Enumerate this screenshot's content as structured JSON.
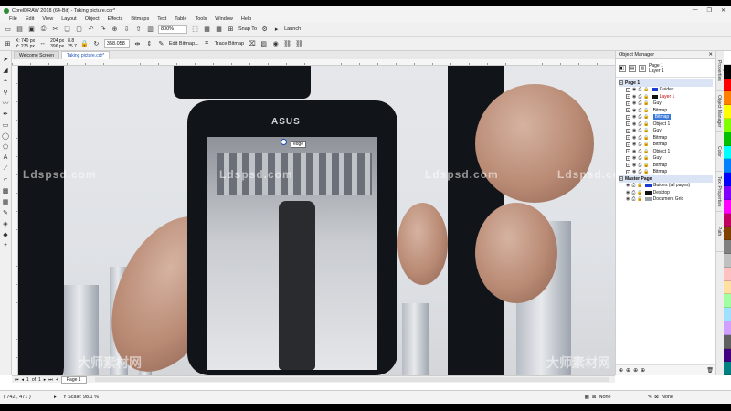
{
  "window": {
    "title": "CorelDRAW 2018 (64-Bit) - Taking picture.cdr*",
    "buttons": [
      "—",
      "❐",
      "✕"
    ]
  },
  "menu": [
    "File",
    "Edit",
    "View",
    "Layout",
    "Object",
    "Effects",
    "Bitmaps",
    "Text",
    "Table",
    "Tools",
    "Window",
    "Help"
  ],
  "toolbar": {
    "zoom": "800%",
    "snap_to": "Snap To",
    "launch": "Launch"
  },
  "property_bar": {
    "x": "X: 740 px",
    "y": "Y: 275 px",
    "w": "204 px",
    "h": "396 px",
    "sx": "8.8",
    "sy": "25.7",
    "angle": "358.058",
    "edit_bitmap": "Edit Bitmap...",
    "trace_bitmap": "Trace Bitmap"
  },
  "tabs": [
    "Welcome Screen",
    "Taking picture.cdr*"
  ],
  "canvas": {
    "watermarks": [
      "Ldspsd.com",
      "Ldspsd.com",
      "Ldspsd.com",
      "Ldspsd.com"
    ],
    "watermark_cn": "大师素材网",
    "phone_brand": "ASUS",
    "tooltip": "edge"
  },
  "object_manager": {
    "title": "Object Manager",
    "page_info": [
      "Page 1",
      "Layer 1"
    ],
    "page1_label": "Page 1",
    "items": [
      {
        "label": "Guides",
        "swatch": "#1a3bd0",
        "style": ""
      },
      {
        "label": "Layer 1",
        "swatch": "#111111",
        "style": "red"
      },
      {
        "label": "Guy",
        "swatch": "",
        "style": ""
      },
      {
        "label": "Bitmap",
        "swatch": "",
        "style": ""
      },
      {
        "label": "Bitmap",
        "swatch": "",
        "style": "selected"
      },
      {
        "label": "Object 1",
        "swatch": "",
        "style": ""
      },
      {
        "label": "Guy",
        "swatch": "",
        "style": ""
      },
      {
        "label": "Bitmap",
        "swatch": "",
        "style": ""
      },
      {
        "label": "Bitmap",
        "swatch": "",
        "style": ""
      },
      {
        "label": "Object 1",
        "swatch": "",
        "style": ""
      },
      {
        "label": "Guy",
        "swatch": "",
        "style": ""
      },
      {
        "label": "Bitmap",
        "swatch": "",
        "style": ""
      },
      {
        "label": "Bitmap",
        "swatch": "",
        "style": ""
      }
    ],
    "master_label": "Master Page",
    "master_items": [
      {
        "label": "Guides (all pages)",
        "swatch": "#1a3bd0"
      },
      {
        "label": "Desktop",
        "swatch": "#111111"
      },
      {
        "label": "Document Grid",
        "swatch": "#9aa0a8"
      }
    ]
  },
  "docker_tabs": [
    "Object Properties",
    "Object Manager",
    "Color",
    "Text Properties",
    "Fit Objects to Path"
  ],
  "palette": [
    "#ffffff",
    "#000000",
    "#ff0000",
    "#ff8000",
    "#ffff00",
    "#80ff00",
    "#00c000",
    "#00ffff",
    "#0080ff",
    "#0000ff",
    "#8000ff",
    "#ff00ff",
    "#c00060",
    "#804000",
    "#808080",
    "#c0c0c0",
    "#ffc0c0",
    "#ffe0a0",
    "#a0ffa0",
    "#a0e0ff",
    "#d0a0ff",
    "#606060",
    "#400080",
    "#008080"
  ],
  "pagebar": {
    "counter": "1",
    "of": "of",
    "total": "1",
    "page_tab": "Page 1"
  },
  "status": {
    "coords": "( 742 , 471 )",
    "scale": "Y Scale: 98.1 %",
    "fill": "None",
    "outline": "None"
  }
}
